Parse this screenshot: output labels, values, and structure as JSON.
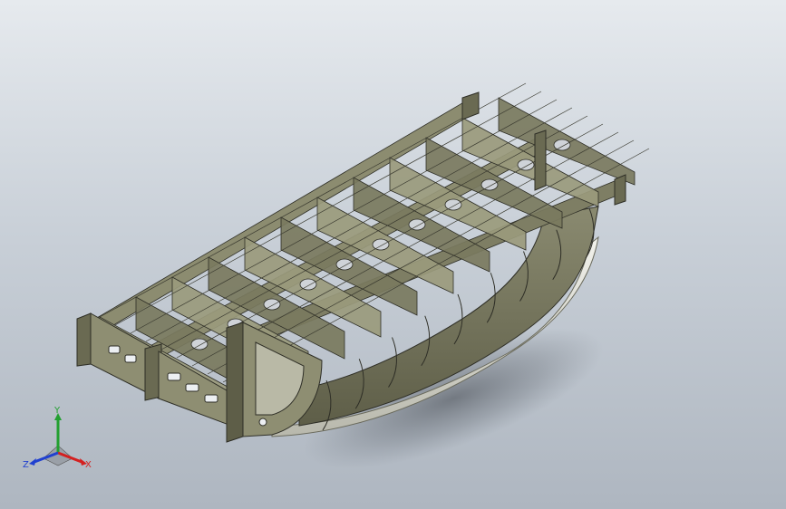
{
  "viewport": {
    "background_top": "#e6eaee",
    "background_bottom": "#aeb6c0"
  },
  "model": {
    "name": "ship-hull-frame-assembly",
    "plate_color": "#7a7a5e",
    "frame_color": "#9a9a7c",
    "edge_color": "#2e2e26",
    "hull_light": "#e4e4dc"
  },
  "triad": {
    "x_label": "X",
    "y_label": "Y",
    "z_label": "Z",
    "x_color": "#d42020",
    "y_color": "#22a030",
    "z_color": "#2040d0"
  }
}
